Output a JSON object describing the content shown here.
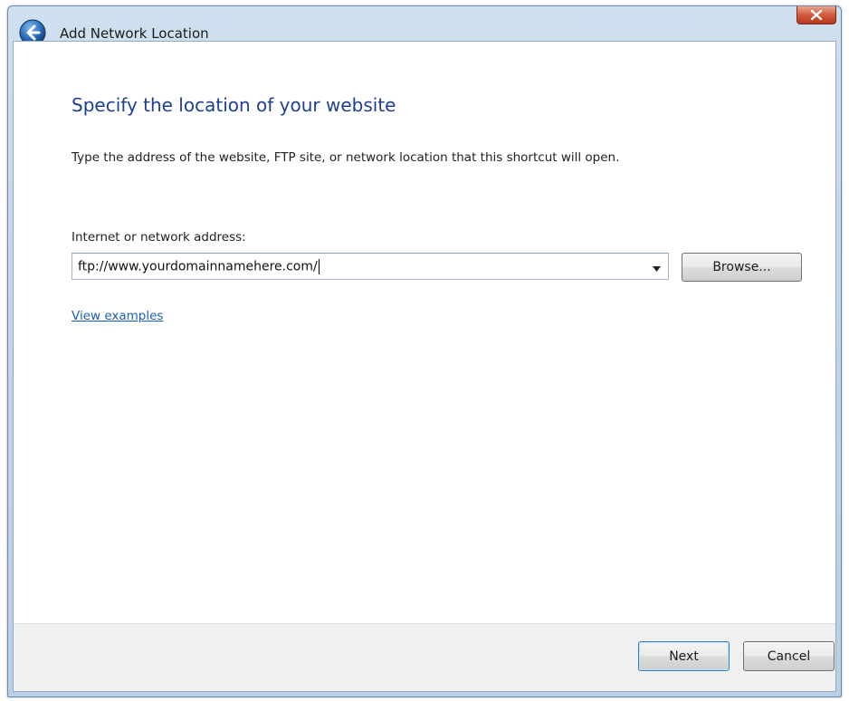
{
  "window": {
    "title": "Add Network Location"
  },
  "page": {
    "heading": "Specify the location of your website",
    "instruction": "Type the address of the website, FTP site, or network location that this shortcut will open.",
    "field_label": "Internet or network address:",
    "address_value": "ftp://www.yourdomainnamehere.com/",
    "browse_label": "Browse...",
    "examples_link": "View examples"
  },
  "footer": {
    "next_label": "Next",
    "cancel_label": "Cancel"
  },
  "colors": {
    "heading": "#1e3f93",
    "link": "#1a5fb4",
    "close_button": "#c94a2c",
    "footer_bg": "#f0f0f0"
  },
  "icons": {
    "back": "back-arrow-icon",
    "close": "close-icon",
    "dropdown": "chevron-down-icon"
  }
}
